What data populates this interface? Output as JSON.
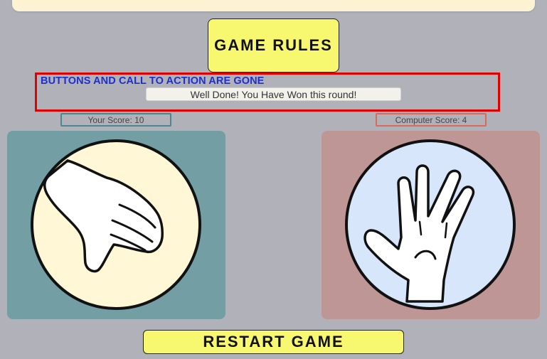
{
  "header": {
    "rules_label": "GAME RULES"
  },
  "annotation": {
    "text": "BUTTONS AND CALL TO ACTION ARE GONE",
    "border_color": "#e00000",
    "text_color": "#1c2fd0"
  },
  "result": {
    "message": "Well Done! You Have Won this round!"
  },
  "scores": {
    "player_label": "Your Score: 10",
    "computer_label": "Computer Score: 4"
  },
  "choices": {
    "player": {
      "icon": "paper-hand-icon",
      "panel_color": "#739ea3",
      "circle_color": "#fff7d6"
    },
    "computer": {
      "icon": "spock-hand-icon",
      "panel_color": "#be9696",
      "circle_color": "#d8e6fb"
    }
  },
  "footer": {
    "restart_label": "RESTART GAME"
  },
  "colors": {
    "background": "#b1b1b9",
    "button": "#f8f870"
  }
}
